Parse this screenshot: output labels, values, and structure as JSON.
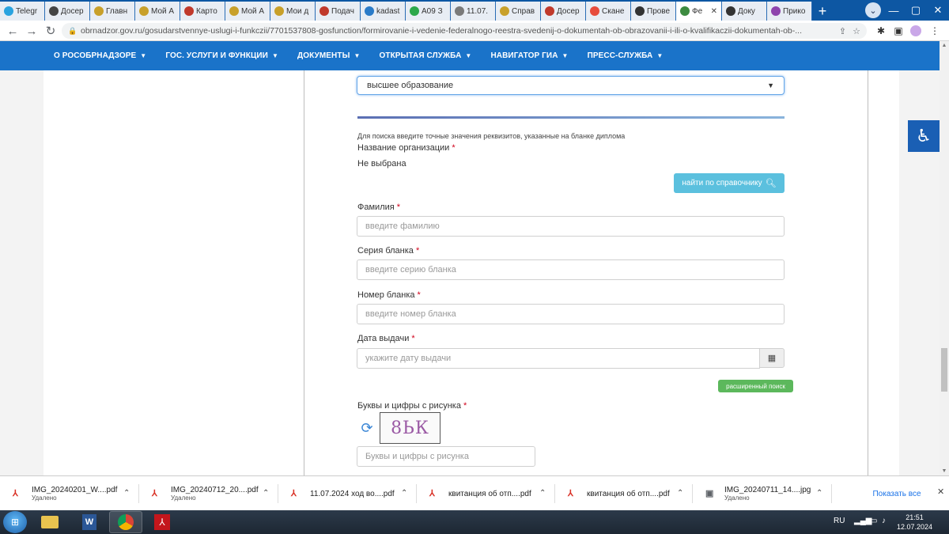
{
  "browser": {
    "tabs": [
      {
        "label": "Telegr",
        "color": "#2aa3df"
      },
      {
        "label": "Досер",
        "color": "#444444"
      },
      {
        "label": "Главн",
        "color": "#c8a02a"
      },
      {
        "label": "Мой А",
        "color": "#c8a02a"
      },
      {
        "label": "Карто",
        "color": "#c0392b"
      },
      {
        "label": "Мой А",
        "color": "#c8a02a"
      },
      {
        "label": "Мои д",
        "color": "#c8a02a"
      },
      {
        "label": "Подач",
        "color": "#c0392b"
      },
      {
        "label": "kadast",
        "color": "#2a7bc8"
      },
      {
        "label": "А09 З",
        "color": "#2ca84a"
      },
      {
        "label": "11.07.",
        "color": "#7a7a7a"
      },
      {
        "label": "Справ",
        "color": "#c8a02a"
      },
      {
        "label": "Досер",
        "color": "#c0392b"
      },
      {
        "label": "Скане",
        "color": "#e74c3c"
      },
      {
        "label": "Прове",
        "color": "#333333"
      },
      {
        "label": "Фе",
        "color": "#3d8b40",
        "active": true
      },
      {
        "label": "Доку",
        "color": "#333333"
      },
      {
        "label": "Прико",
        "color": "#8e44ad"
      }
    ],
    "new_tab": "+",
    "url": "obrnadzor.gov.ru/gosudarstvennye-uslugi-i-funkczii/7701537808-gosfunction/formirovanie-i-vedenie-federalnogo-reestra-svedenij-o-dokumentah-ob-obrazovanii-i-ili-o-kvalifikaczii-dokumentah-ob-..."
  },
  "site_nav": {
    "items": [
      "О РОСОБРНАДЗОРЕ",
      "ГОС. УСЛУГИ И ФУНКЦИИ",
      "ДОКУМЕНТЫ",
      "ОТКРЫТАЯ СЛУЖБА",
      "НАВИГАТОР ГИА",
      "ПРЕСС-СЛУЖБА"
    ]
  },
  "form": {
    "level_select": "высшее образование",
    "hint": "Для поиска введите точные значения реквизитов, указанные на бланке диплома",
    "org_label": "Название организации",
    "org_value": "Не выбрана",
    "find_button": "найти по справочнику",
    "surname_label": "Фамилия",
    "surname_placeholder": "введите фамилию",
    "series_label": "Серия бланка",
    "series_placeholder": "введите серию бланка",
    "number_label": "Номер бланка",
    "number_placeholder": "введите номер бланка",
    "date_label": "Дата выдачи",
    "date_placeholder": "укажите дату выдачи",
    "advanced_button": "расширенный поиск",
    "captcha_label": "Буквы и цифры с рисунка",
    "captcha_text": "8ЬК",
    "captcha_placeholder": "Буквы и цифры с рисунка",
    "required_mark": "*"
  },
  "downloads": {
    "items": [
      {
        "name": "IMG_20240201_W....pdf",
        "status": "Удалено"
      },
      {
        "name": "IMG_20240712_20....pdf",
        "status": "Удалено"
      },
      {
        "name": "11.07.2024 ход во....pdf",
        "status": ""
      },
      {
        "name": "квитанция об отп....pdf",
        "status": ""
      },
      {
        "name": "квитанция об отп....pdf",
        "status": ""
      },
      {
        "name": "IMG_20240711_14....jpg",
        "status": "Удалено"
      }
    ],
    "show_all": "Показать все"
  },
  "taskbar": {
    "lang": "RU",
    "time": "21:51",
    "date": "12.07.2024"
  }
}
